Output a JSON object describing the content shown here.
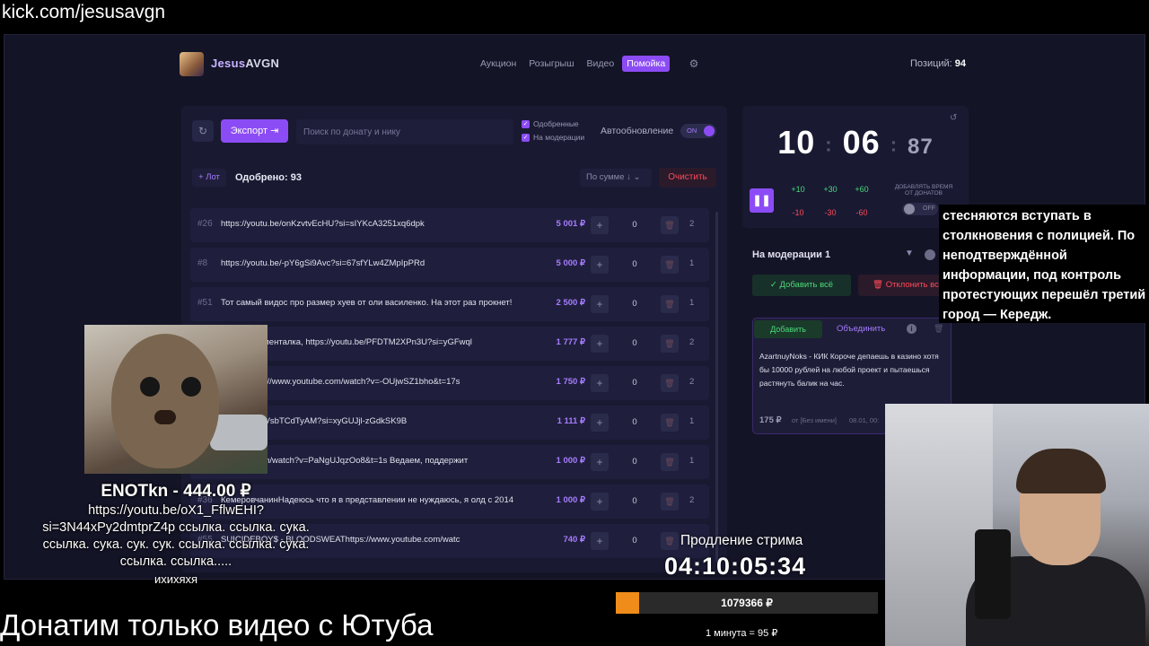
{
  "browser": {
    "url": "kick.com/jesusavgn"
  },
  "header": {
    "logo_first": "Jesus",
    "logo_second": "AVGN",
    "tabs": [
      {
        "label": "Аукцион",
        "active": false
      },
      {
        "label": "Розыгрыш",
        "active": false
      },
      {
        "label": "Видео",
        "active": false
      },
      {
        "label": "Помойка",
        "active": true
      }
    ],
    "settings_icon": "gear-icon",
    "positions_label": "Позиций:",
    "positions_value": "94"
  },
  "toolbar": {
    "refresh_icon": "refresh-icon",
    "export_label": "Экспорт",
    "search_placeholder": "Поиск по донату и нику",
    "filter_approved": "Одобренные",
    "filter_moderation": "На модерации",
    "autoupdate_label": "Автообновление",
    "autoupdate_state": "ON"
  },
  "list_header": {
    "lot_button": "+ Лот",
    "approved_text": "Одобрено: 93",
    "sort_label": "По сумме ↓",
    "clear_label": "Очистить"
  },
  "donations": [
    {
      "num": "#26",
      "message": "https://youtu.be/onKzvtvEcHU?si=sIYKcA3251xq6dpk",
      "amount": "5 001 ₽",
      "qty": "0",
      "count": "2"
    },
    {
      "num": "#8",
      "message": "https://youtu.be/-pY6gSi9Avc?si=67sfYLw4ZMpIpPRd",
      "amount": "5 000 ₽",
      "qty": "0",
      "count": "1"
    },
    {
      "num": "#51",
      "message": "Тот самый видос про размер хуев от оли василенко. На этот раз прокнет!",
      "amount": "2 500 ₽",
      "qty": "0",
      "count": "1"
    },
    {
      "num": "",
      "message": "н, вот документалка, https://youtu.be/PFDTM2XPn3U?si=yGFwql",
      "amount": "1 777 ₽",
      "qty": "0",
      "count": "2"
    },
    {
      "num": "",
      "message": "манга https://www.youtube.com/watch?v=-OUjwSZ1bho&t=17s",
      "amount": "1 750 ₽",
      "qty": "0",
      "count": "2"
    },
    {
      "num": "",
      "message": "/youtu.be/CVsbTCdTyAM?si=xyGUJjl-zGdkSK9B",
      "amount": "1 111 ₽",
      "qty": "0",
      "count": "1"
    },
    {
      "num": "",
      "message": "youtube.com/watch?v=PaNgUJqzOo8&t=1s Ведаем, поддержит",
      "amount": "1 000 ₽",
      "qty": "0",
      "count": "1"
    },
    {
      "num": "#36",
      "message": "КемеровчанинНадеюсь что я в представлении не нуждаюсь, я олд с 2014",
      "amount": "1 000 ₽",
      "qty": "0",
      "count": "2"
    },
    {
      "num": "#55",
      "message": "SUICIDEBOY$ - BLOODSWEAThttps://www.youtube.com/watc",
      "amount": "740 ₽",
      "qty": "0",
      "count": "1"
    }
  ],
  "timer": {
    "hours": "10",
    "minutes": "06",
    "ms": "87",
    "add_buttons": [
      "+10",
      "+30",
      "+60"
    ],
    "sub_buttons": [
      "-10",
      "-30",
      "-60"
    ],
    "add_time_label": "ДОБАВЛЯТЬ ВРЕМЯ ОТ ДОНАТОВ",
    "toggle_state": "OFF"
  },
  "moderation": {
    "title": "На модерации",
    "count": "1",
    "add_all": "✓ Добавить всё",
    "reject_all": "🗑 Отклонить всё",
    "card": {
      "add_label": "Добавить",
      "merge_label": "Объединить",
      "text": "AzartnuyNoks - КИК Короче депаешь в казино хотя бы 10000 рублей на любой проект и пытаешься растянуть балик на час.",
      "amount": "175 ₽",
      "from": "от [Без имени]",
      "date": "08.01, 00:"
    }
  },
  "news_overlay": {
    "text": "стесняются вступать в столкновения с полицией. По неподтверждённой информации, под контроль протестующих перешёл третий город — Кередж."
  },
  "donation_alert": {
    "donor": "ENOTkn - 444.00 ₽",
    "message": "https://youtu.be/oX1_FflwEHI?si=3N44xPy2dmtprZ4p ссылка. ссылка. сука. ссылка. сука. сук. сук. ссылка. ссылка. сука. ссылка. ссылка.....",
    "extra": "ихихяхя"
  },
  "stream_extension": {
    "label": "Продление стрима",
    "timer": "04:10:05:34",
    "goal_text": "1079366 ₽",
    "progress": 0.09,
    "rate": "1 минута = 95 ₽"
  },
  "bottom_title": "Донатим только видео с Ютуба",
  "colors": {
    "accent": "#8c4cf5",
    "green": "#4cd97a",
    "red": "#ff4a5a",
    "orange": "#f08c1a"
  }
}
